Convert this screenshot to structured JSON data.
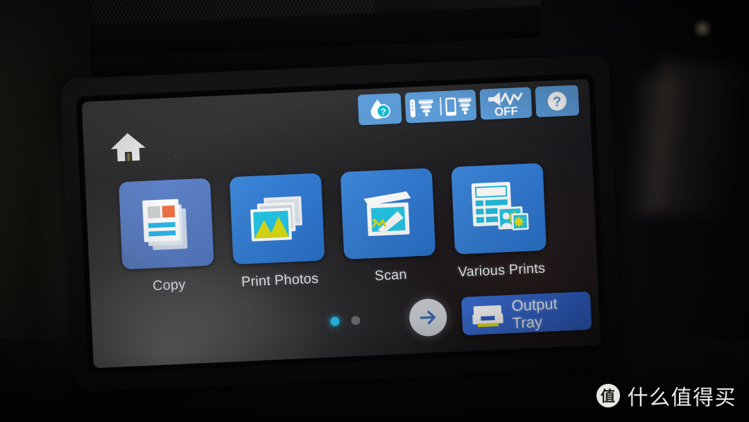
{
  "device": {
    "type": "inkjet-printer-touchscreen",
    "screen_title": "Home"
  },
  "statusbar": {
    "items": [
      {
        "id": "ink-status",
        "icon": "ink-drop-question-icon",
        "label": "Ink status"
      },
      {
        "id": "network",
        "icon": "wireless-lan-icon",
        "label": "Wireless LAN"
      },
      {
        "id": "wireless-direct",
        "icon": "wireless-direct-icon",
        "label": "Wireless Direct"
      },
      {
        "id": "quiet-mode",
        "icon": "quiet-mode-icon",
        "label": "OFF",
        "value": "OFF"
      },
      {
        "id": "help",
        "icon": "help-question-icon",
        "label": "Help"
      }
    ]
  },
  "home_button": {
    "icon": "home-icon",
    "label": "Home"
  },
  "tiles": [
    {
      "id": "copy",
      "label": "Copy",
      "icon": "copy-document-icon",
      "tile_color": "#5b7fc6",
      "selected": true
    },
    {
      "id": "print-photos",
      "label": "Print Photos",
      "icon": "photo-stack-icon",
      "tile_color": "#2f7ed6",
      "selected": false
    },
    {
      "id": "scan",
      "label": "Scan",
      "icon": "flatbed-scanner-icon",
      "tile_color": "#2f7ed6",
      "selected": false
    },
    {
      "id": "various-prints",
      "label": "Various Prints",
      "icon": "calendar-photos-icon",
      "tile_color": "#2f7ed6",
      "selected": false
    }
  ],
  "pagination": {
    "total_pages": 2,
    "current_page": 1,
    "next_icon": "arrow-right-icon"
  },
  "output_tray": {
    "line1": "Output",
    "line2": "Tray",
    "icon": "printer-tray-icon"
  },
  "watermark": {
    "logo_char": "值",
    "text": "什么值得买"
  },
  "colors": {
    "status_button": "#5a9ad6",
    "tile_blue": "#2f7ed6",
    "tile_blue_selected": "#5b7fc6",
    "tray_button": "#3b6fd6",
    "dot_active": "#27c6f5",
    "dot_inactive": "#868b90",
    "icon_cyan": "#24bfe0",
    "icon_yellow": "#e3e018",
    "icon_orange": "#ef7346"
  }
}
